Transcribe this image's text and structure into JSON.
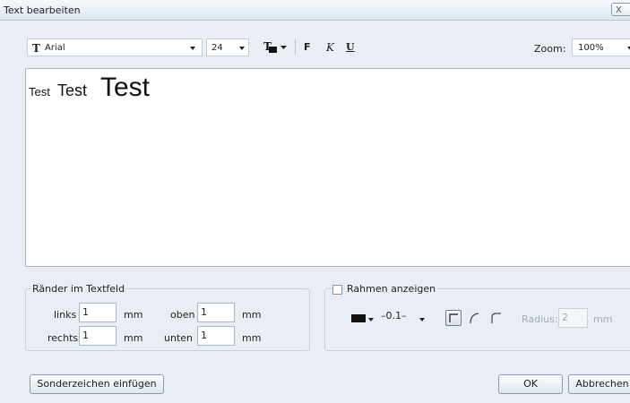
{
  "window": {
    "title": "Text bearbeiten",
    "close_label": "X"
  },
  "toolbar": {
    "font_icon": "T",
    "font_name": "Arial",
    "font_size": "24",
    "text_color_icon": "text-color-icon",
    "bold_label": "F",
    "italic_label": "K",
    "underline_label": "U",
    "zoom_label": "Zoom:",
    "zoom_value": "100%"
  },
  "editor": {
    "runs": [
      {
        "text": "Test"
      },
      {
        "text": "Test"
      },
      {
        "text": "Test"
      }
    ]
  },
  "margins": {
    "title": "Ränder im Textfeld",
    "left_label": "links",
    "left_value": "1",
    "right_label": "rechts",
    "right_value": "1",
    "top_label": "oben",
    "top_value": "1",
    "bottom_label": "unten",
    "bottom_value": "1",
    "unit": "mm"
  },
  "frame": {
    "checkbox_label": "Rahmen anzeigen",
    "checked": false,
    "line_width": "0.1",
    "radius_label": "Radius:",
    "radius_value": "2",
    "unit": "mm"
  },
  "buttons": {
    "special_chars": "Sonderzeichen einfügen",
    "ok": "OK",
    "cancel": "Abbrechen"
  }
}
